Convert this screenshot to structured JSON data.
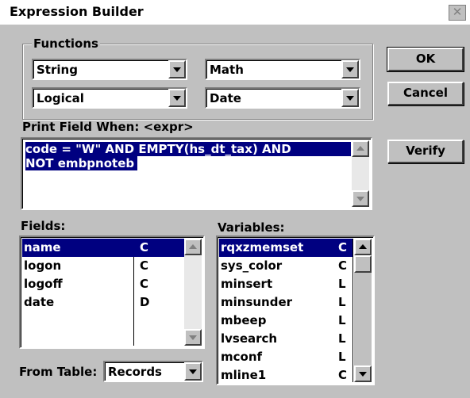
{
  "window": {
    "title": "Expression Builder",
    "close_glyph": "✕"
  },
  "functions": {
    "group_label": "Functions",
    "string": "String",
    "math": "Math",
    "logical": "Logical",
    "date": "Date"
  },
  "buttons": {
    "ok": "OK",
    "cancel": "Cancel",
    "verify": "Verify"
  },
  "expression": {
    "label": "Print Field When: <expr>",
    "line1": "code = \"W\" AND EMPTY(hs_dt_tax) AND",
    "line2": "NOT embpnoteb"
  },
  "fields": {
    "label": "Fields:",
    "items": [
      {
        "name": "name",
        "type": "C"
      },
      {
        "name": "logon",
        "type": "C"
      },
      {
        "name": "logoff",
        "type": "C"
      },
      {
        "name": "date",
        "type": "D"
      }
    ]
  },
  "variables": {
    "label": "Variables:",
    "items": [
      {
        "name": "rqxzmemset",
        "type": "C"
      },
      {
        "name": "sys_color",
        "type": "C"
      },
      {
        "name": "minsert",
        "type": "L"
      },
      {
        "name": "minsunder",
        "type": "L"
      },
      {
        "name": "mbeep",
        "type": "L"
      },
      {
        "name": "lvsearch",
        "type": "L"
      },
      {
        "name": "mconf",
        "type": "L"
      },
      {
        "name": "mline1",
        "type": "C"
      }
    ]
  },
  "from_table": {
    "label": "From Table:",
    "value": "Records"
  },
  "colors": {
    "selection": "#000080",
    "face": "#c0c0c0"
  }
}
